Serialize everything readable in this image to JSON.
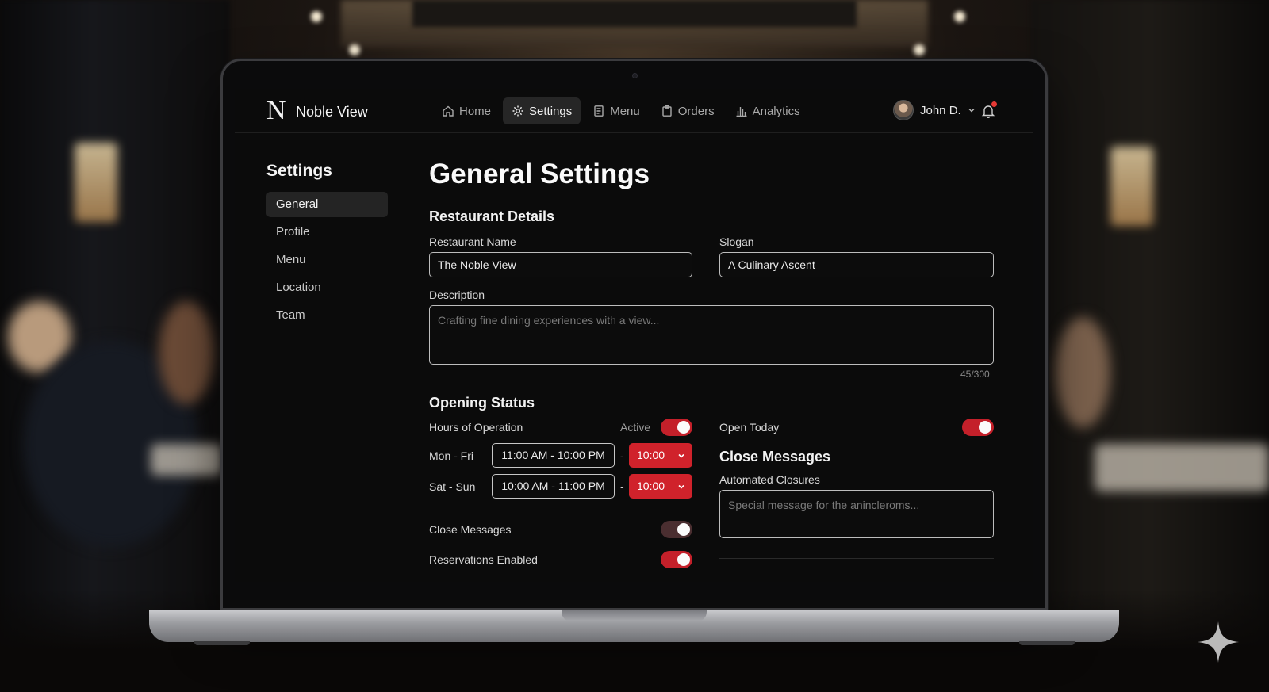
{
  "brand": {
    "logo_letter": "N",
    "name": "Noble View"
  },
  "nav": {
    "items": [
      {
        "label": "Home",
        "icon": "home-icon"
      },
      {
        "label": "Settings",
        "icon": "gear-icon",
        "active": true
      },
      {
        "label": "Menu",
        "icon": "menu-document-icon"
      },
      {
        "label": "Orders",
        "icon": "clipboard-icon"
      },
      {
        "label": "Analytics",
        "icon": "bar-chart-icon"
      }
    ]
  },
  "user": {
    "name": "John D."
  },
  "sidebar": {
    "title": "Settings",
    "items": [
      {
        "label": "General",
        "active": true
      },
      {
        "label": "Profile"
      },
      {
        "label": "Menu"
      },
      {
        "label": "Location"
      },
      {
        "label": "Team"
      }
    ]
  },
  "main": {
    "title": "General Settings",
    "restaurant_details": {
      "heading": "Restaurant Details",
      "name_label": "Restaurant Name",
      "name_value": "The Noble View",
      "slogan_label": "Slogan",
      "slogan_value": "A Culinary Ascent",
      "description_label": "Description",
      "description_placeholder": "Crafting fine dining experiences with a view...",
      "description_counter": "45/300"
    },
    "opening_status": {
      "heading": "Opening Status",
      "hours_label": "Hours of Operation",
      "active_label": "Active",
      "hours_toggle_on": true,
      "rows": [
        {
          "days": "Mon - Fri",
          "range": "11:00 AM - 10:00 PM",
          "separator": "-",
          "select": "10:00"
        },
        {
          "days": "Sat - Sun",
          "range": "10:00 AM - 11:00 PM",
          "separator": "-",
          "select": "10:00"
        }
      ],
      "close_messages_label": "Close Messages",
      "close_messages_toggle_on": false,
      "reservations_label": "Reservations Enabled",
      "reservations_toggle_on": true,
      "open_today_label": "Open Today",
      "open_today_toggle_on": true
    },
    "close_messages": {
      "heading": "Close Messages",
      "automated_label": "Automated Closures",
      "automated_placeholder": "Special message for the anincleroms..."
    }
  },
  "colors": {
    "accent": "#d0222b",
    "background": "#0b0b0b",
    "text": "#e9e9e9",
    "toggle_off": "#4a2e30"
  }
}
